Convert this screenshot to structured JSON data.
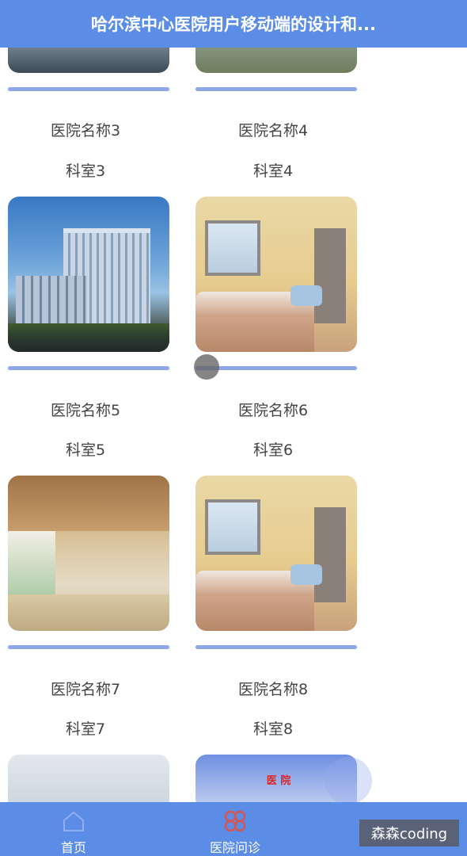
{
  "header": {
    "title": "哈尔滨中心医院用户移动端的设计和..."
  },
  "hospitals": [
    {
      "name": "医院名称3",
      "dept": "科室3"
    },
    {
      "name": "医院名称4",
      "dept": "科室4"
    },
    {
      "name": "医院名称5",
      "dept": "科室5"
    },
    {
      "name": "医院名称6",
      "dept": "科室6"
    },
    {
      "name": "医院名称7",
      "dept": "科室7"
    },
    {
      "name": "医院名称8",
      "dept": "科室8"
    }
  ],
  "bottom_sign": "医 院",
  "nav": {
    "home_label": "首页",
    "clinic_label": "医院问诊"
  },
  "watermark": "森森coding",
  "colors": {
    "primary": "#5b8de6",
    "bar": "#8fa7e6",
    "clinic_icon": "#d9534f"
  }
}
